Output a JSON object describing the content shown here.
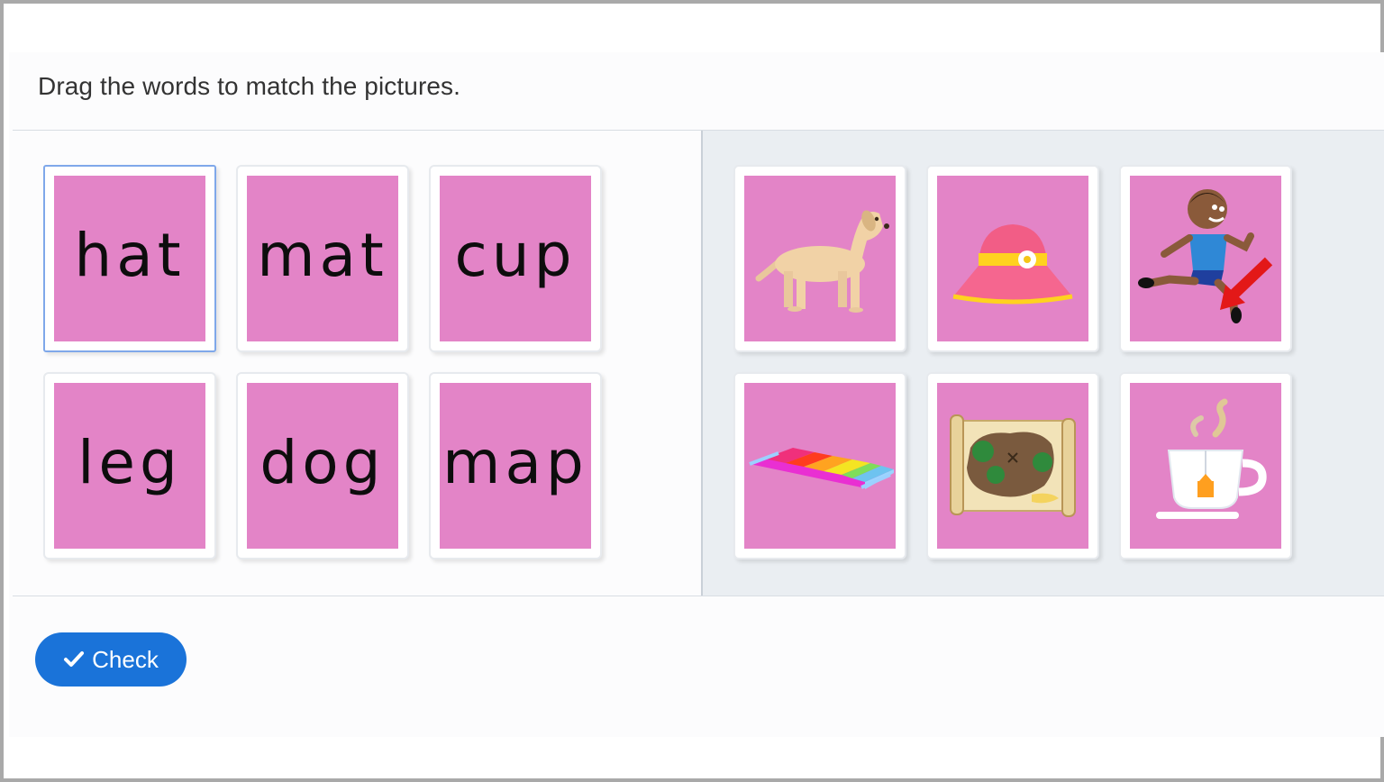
{
  "instruction": "Drag the words to match the pictures.",
  "words": [
    {
      "label": "hat",
      "selected": true
    },
    {
      "label": "mat"
    },
    {
      "label": "cup"
    },
    {
      "label": "leg"
    },
    {
      "label": "dog"
    },
    {
      "label": "map"
    }
  ],
  "pictures": [
    {
      "icon": "dog-icon"
    },
    {
      "icon": "sun-hat-icon"
    },
    {
      "icon": "running-boy-leg-icon"
    },
    {
      "icon": "striped-mat-icon"
    },
    {
      "icon": "treasure-map-icon"
    },
    {
      "icon": "tea-cup-icon"
    }
  ],
  "check_button": {
    "label": "Check",
    "icon": "checkmark-icon"
  },
  "colors": {
    "card_fill": "#e384c7",
    "button": "#1a73d9",
    "picture_zone": "#eaeef2",
    "selected_border": "#7fa8ea"
  }
}
